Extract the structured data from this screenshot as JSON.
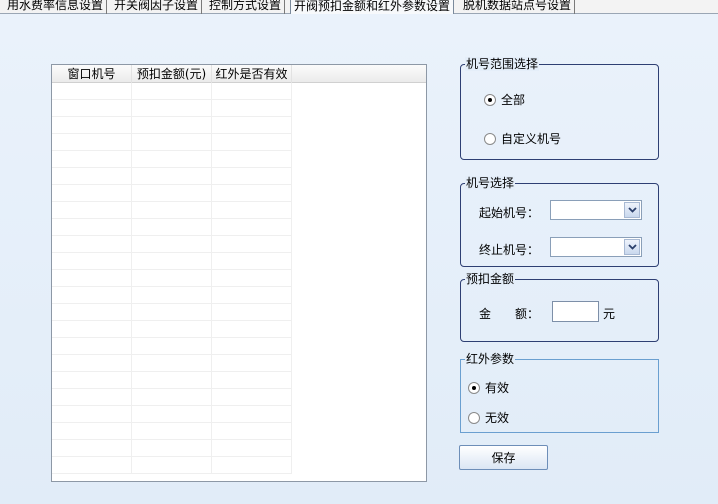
{
  "tabs": [
    {
      "label": "用水费率信息设置",
      "active": false
    },
    {
      "label": "开关阀因子设置",
      "active": false
    },
    {
      "label": "控制方式设置",
      "active": false
    },
    {
      "label": "开阀预扣金额和红外参数设置",
      "active": true
    },
    {
      "label": "脱机数据站点号设置",
      "active": false
    }
  ],
  "list": {
    "columns": [
      "窗口机号",
      "预扣金额(元)",
      "红外是否有效"
    ]
  },
  "range_group": {
    "title": "机号范围选择",
    "option_all": "全部",
    "option_custom": "自定义机号",
    "selected": "all"
  },
  "machine_group": {
    "title": "机号选择",
    "start_label": "起始机号：",
    "end_label": "终止机号：",
    "start_value": "",
    "end_value": ""
  },
  "amount_group": {
    "title": "预扣金额",
    "label": "金　　额：",
    "value": "",
    "unit": "元"
  },
  "infrared_group": {
    "title": "红外参数",
    "option_valid": "有效",
    "option_invalid": "无效",
    "selected": "valid"
  },
  "save_label": "保存"
}
